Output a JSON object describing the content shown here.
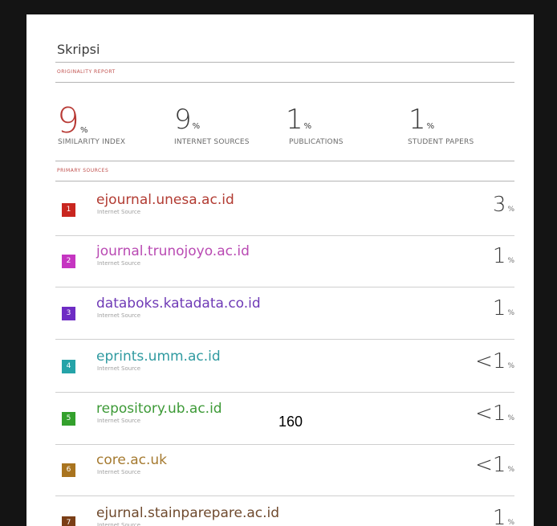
{
  "document": {
    "title": "Skripsi",
    "originality_label": "ORIGINALITY REPORT",
    "primary_sources_label": "PRIMARY SOURCES",
    "page_number": "160"
  },
  "summary": [
    {
      "value": "9",
      "unit": "%",
      "label": "SIMILARITY INDEX"
    },
    {
      "value": "9",
      "unit": "%",
      "label": "INTERNET SOURCES"
    },
    {
      "value": "1",
      "unit": "%",
      "label": "PUBLICATIONS"
    },
    {
      "value": "1",
      "unit": "%",
      "label": "STUDENT PAPERS"
    }
  ],
  "sources": [
    {
      "rank": "1",
      "name": "ejournal.unesa.ac.id",
      "type": "Internet Source",
      "percent": "3",
      "unit": "%",
      "color": "#c9261f",
      "text_color": "#b23b32"
    },
    {
      "rank": "2",
      "name": "journal.trunojoyo.ac.id",
      "type": "Internet Source",
      "percent": "1",
      "unit": "%",
      "color": "#c535c1",
      "text_color": "#b94ab3"
    },
    {
      "rank": "3",
      "name": "databoks.katadata.co.id",
      "type": "Internet Source",
      "percent": "1",
      "unit": "%",
      "color": "#6e2cc4",
      "text_color": "#6f3ab6"
    },
    {
      "rank": "4",
      "name": "eprints.umm.ac.id",
      "type": "Internet Source",
      "percent": "<1",
      "unit": "%",
      "color": "#25a3a8",
      "text_color": "#2f9aa0"
    },
    {
      "rank": "5",
      "name": "repository.ub.ac.id",
      "type": "Internet Source",
      "percent": "<1",
      "unit": "%",
      "color": "#33a02c",
      "text_color": "#3d9a37"
    },
    {
      "rank": "6",
      "name": "core.ac.uk",
      "type": "Internet Source",
      "percent": "<1",
      "unit": "%",
      "color": "#a9741f",
      "text_color": "#a57a30"
    },
    {
      "rank": "7",
      "name": "ejurnal.stainparepare.ac.id",
      "type": "Internet Source",
      "percent": "1",
      "unit": "%",
      "color": "#7a3e16",
      "text_color": "#6f4a2e"
    }
  ]
}
